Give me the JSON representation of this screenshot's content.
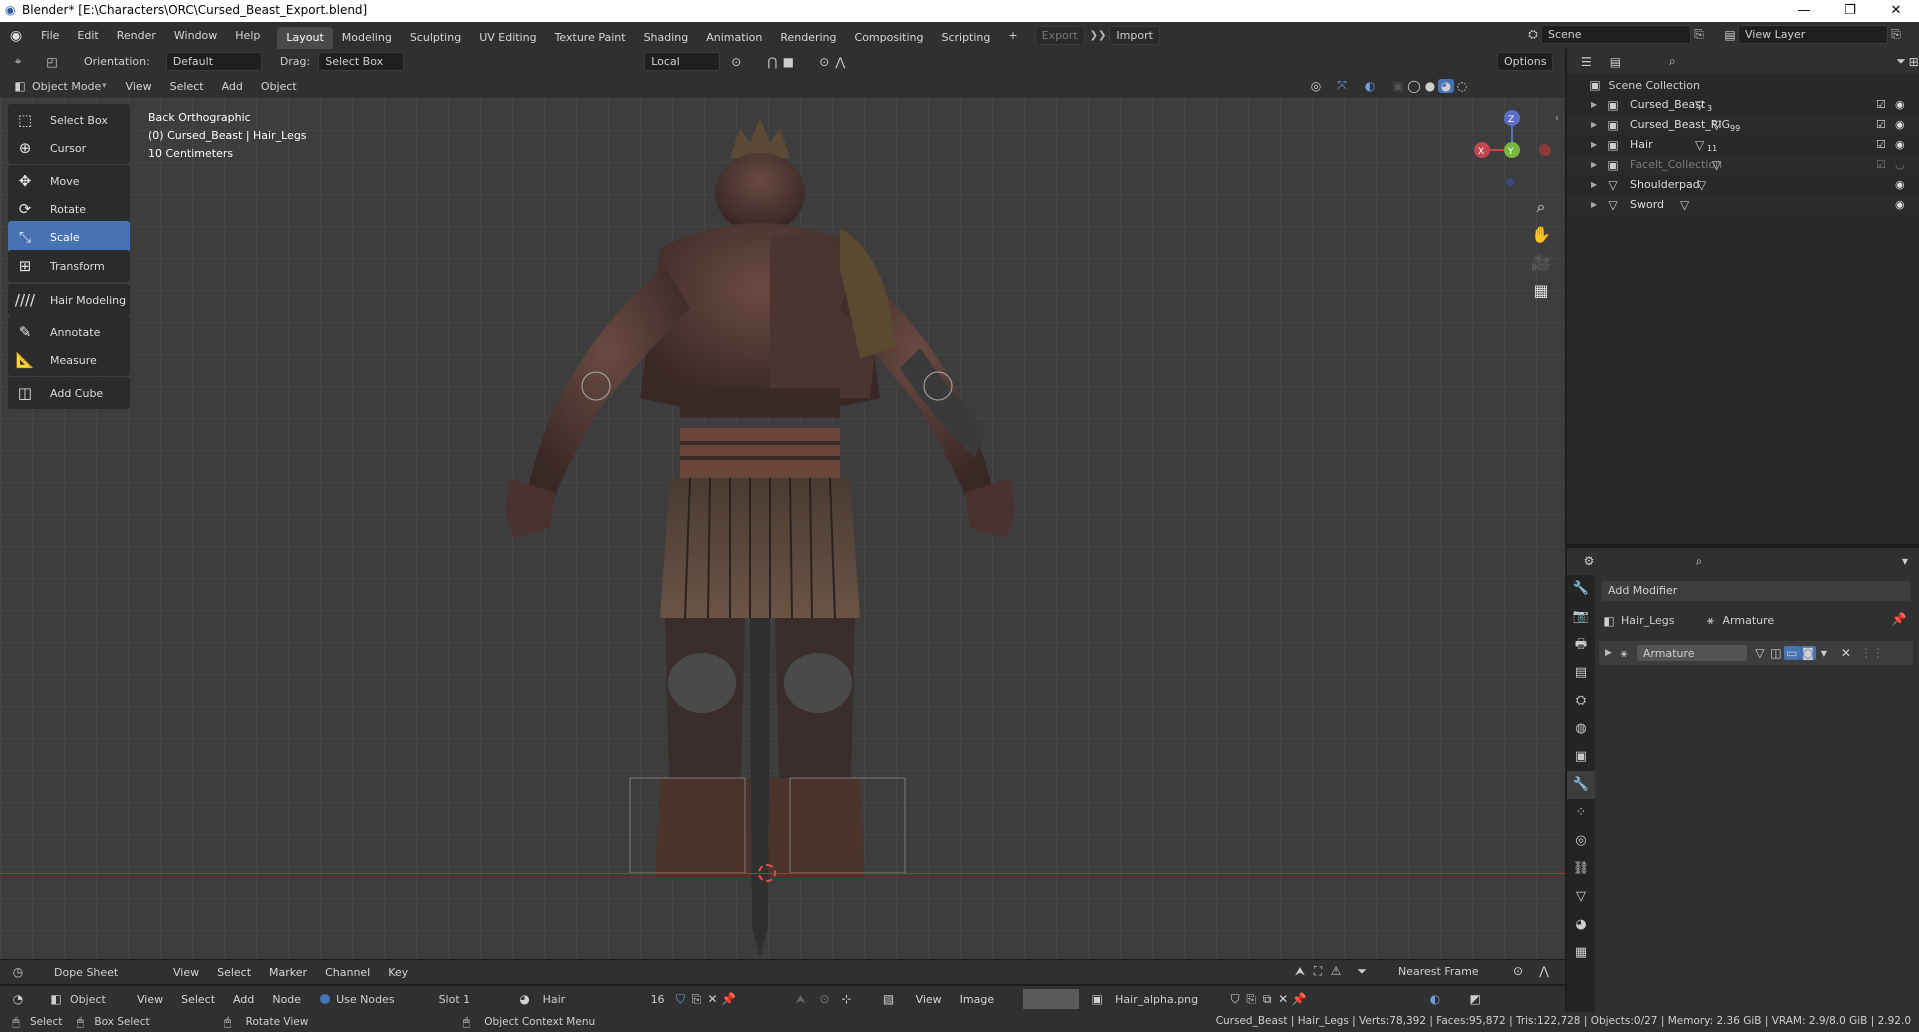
{
  "window": {
    "title": "Blender* [E:\\Characters\\ORC\\Cursed_Beast_Export.blend]",
    "minimize": "—",
    "maximize": "❐",
    "close": "✕"
  },
  "menu": [
    "File",
    "Edit",
    "Render",
    "Window",
    "Help"
  ],
  "workspaces": [
    "Layout",
    "Modeling",
    "Sculpting",
    "UV Editing",
    "Texture Paint",
    "Shading",
    "Animation",
    "Rendering",
    "Compositing",
    "Scripting"
  ],
  "workspace_add": "+",
  "export_label": "Export",
  "import_label": "Import",
  "scene": {
    "label": "Scene",
    "view_layer": "View Layer"
  },
  "tool_header": {
    "orientation_label": "Orientation:",
    "orientation_value": "Default",
    "drag_label": "Drag:",
    "drag_value": "Select Box",
    "pivot_value": "Local",
    "options_label": "Options"
  },
  "viewport_header": {
    "mode": "Object Mode",
    "menus": [
      "View",
      "Select",
      "Add",
      "Object"
    ]
  },
  "tools": [
    {
      "label": "Select Box",
      "icon": "select-box-icon",
      "glyph": "⬚"
    },
    {
      "label": "Cursor",
      "icon": "cursor-icon",
      "glyph": "⊕"
    },
    {
      "label": "Move",
      "icon": "move-icon",
      "glyph": "✥"
    },
    {
      "label": "Rotate",
      "icon": "rotate-icon",
      "glyph": "⟳"
    },
    {
      "label": "Scale",
      "icon": "scale-icon",
      "glyph": "⤡"
    },
    {
      "label": "Transform",
      "icon": "transform-icon",
      "glyph": "⊞"
    },
    {
      "label": "Hair Modeling",
      "icon": "hair-icon",
      "glyph": "////"
    },
    {
      "label": "Annotate",
      "icon": "annotate-icon",
      "glyph": "✎"
    },
    {
      "label": "Measure",
      "icon": "measure-icon",
      "glyph": "📐"
    },
    {
      "label": "Add Cube",
      "icon": "add-cube-icon",
      "glyph": "◫"
    }
  ],
  "active_tool": "Scale",
  "viewport_info": {
    "view": "Back Orthographic",
    "object": "(0) Cursed_Beast | Hair_Legs",
    "scale": "10 Centimeters"
  },
  "gizmo": {
    "z": "Z",
    "y": "Y",
    "x": "X"
  },
  "outliner": {
    "root": "Scene Collection",
    "items": [
      {
        "name": "Cursed_Beast",
        "type": "collection",
        "badge": "3",
        "dim": false
      },
      {
        "name": "Cursed_Beast_RIG",
        "type": "collection",
        "badge": "99",
        "dim": false
      },
      {
        "name": "Hair",
        "type": "collection",
        "badge": "11",
        "dim": false
      },
      {
        "name": "Facelt_Collection",
        "type": "collection",
        "badge": "",
        "dim": true
      },
      {
        "name": "Shoulderpad",
        "type": "mesh",
        "badge": "",
        "dim": false
      },
      {
        "name": "Sword",
        "type": "mesh",
        "badge": "",
        "dim": false
      }
    ]
  },
  "properties": {
    "add_modifier": "Add Modifier",
    "object_name": "Hair_Legs",
    "armature_ref": "Armature",
    "modifier_name": "Armature"
  },
  "dope_sheet": {
    "editor": "Dope Sheet",
    "menus": [
      "View",
      "Select",
      "Marker",
      "Channel",
      "Key"
    ],
    "snap": "Nearest Frame"
  },
  "node_bar": {
    "mode": "Object",
    "menus": [
      "View",
      "Select",
      "Add",
      "Node"
    ],
    "use_nodes": "Use Nodes",
    "slot": "Slot 1",
    "material": "Hair",
    "users": "16",
    "image_menus": [
      "View",
      "Image"
    ],
    "image_name": "Hair_alpha.png"
  },
  "status": {
    "select": "Select",
    "box_select": "Box Select",
    "rotate_view": "Rotate View",
    "context_menu": "Object Context Menu",
    "stats": "Cursed_Beast | Hair_Legs | Verts:78,392 | Faces:95,872 | Tris:122,728 | Objects:0/27 | Memory: 2.36 GiB | VRAM: 2.9/8.0 GiB | 2.92.0"
  }
}
